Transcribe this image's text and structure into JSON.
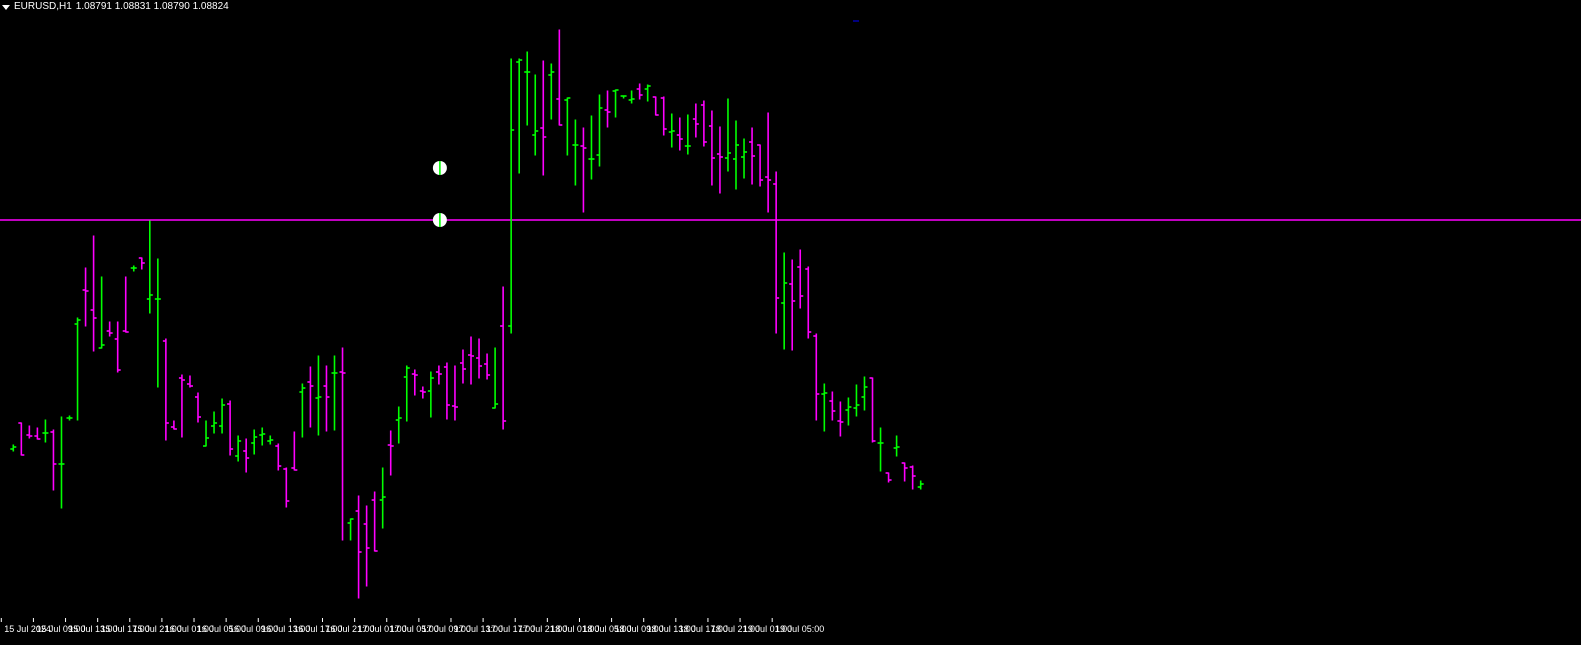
{
  "header": {
    "symbol_timeframe": "EURUSD,H1",
    "ohlc": "1.08791 1.08831 1.08790 1.08824"
  },
  "colors": {
    "background": "#000000",
    "bull": "#00ff00",
    "bear": "#ff00ff",
    "hline": "#ff00ff",
    "text": "#ffffff"
  },
  "chart_data": {
    "type": "ohlc-bar",
    "symbol": "EURUSD",
    "timeframe": "H1",
    "x_tick_labels": [
      "15 Jul 2024",
      "15 Jul 09:00",
      "15 Jul 13:00",
      "15 Jul 17:00",
      "15 Jul 21:00",
      "16 Jul 01:00",
      "16 Jul 05:00",
      "16 Jul 09:00",
      "16 Jul 13:00",
      "16 Jul 17:00",
      "16 Jul 21:00",
      "17 Jul 01:00",
      "17 Jul 05:00",
      "17 Jul 09:00",
      "17 Jul 13:00",
      "17 Jul 17:00",
      "17 Jul 21:00",
      "18 Jul 01:00",
      "18 Jul 05:00",
      "18 Jul 09:00",
      "18 Jul 13:00",
      "18 Jul 17:00",
      "18 Jul 21:00",
      "19 Jul 01:00",
      "19 Jul 05:00"
    ],
    "horizontal_line": {
      "level": 220
    },
    "markers": [
      {
        "bar": 53,
        "level": 168
      },
      {
        "bar": 53,
        "level": 220
      }
    ],
    "bars": [
      [
        449,
        447,
        445,
        451
      ],
      [
        423,
        455,
        423,
        455
      ],
      [
        435,
        436,
        426,
        438
      ],
      [
        436,
        439,
        428,
        439
      ],
      [
        433,
        433,
        420,
        442
      ],
      [
        432,
        464,
        430,
        490
      ],
      [
        464,
        464,
        417,
        508
      ],
      [
        418,
        418,
        416,
        420
      ],
      [
        324,
        320,
        318,
        420
      ],
      [
        290,
        291,
        268,
        326
      ],
      [
        310,
        318,
        236,
        351
      ],
      [
        348,
        345,
        277,
        345
      ],
      [
        331,
        333,
        322,
        336
      ],
      [
        339,
        370,
        322,
        372
      ],
      [
        331,
        332,
        277,
        332
      ],
      [
        268,
        268,
        266,
        271
      ],
      [
        258,
        263,
        258,
        269
      ],
      [
        299,
        295,
        221,
        313
      ],
      [
        299,
        299,
        259,
        387
      ],
      [
        341,
        423,
        339,
        440
      ],
      [
        427,
        429,
        421,
        429
      ],
      [
        378,
        380,
        375,
        437
      ],
      [
        384,
        386,
        376,
        387
      ],
      [
        397,
        417,
        393,
        422
      ],
      [
        446,
        438,
        421,
        446
      ],
      [
        426,
        423,
        412,
        433
      ],
      [
        426,
        405,
        399,
        433
      ],
      [
        404,
        449,
        401,
        455
      ],
      [
        456,
        441,
        436,
        461
      ],
      [
        451,
        458,
        439,
        472
      ],
      [
        443,
        437,
        430,
        454
      ],
      [
        435,
        434,
        428,
        445
      ],
      [
        441,
        440,
        436,
        444
      ],
      [
        446,
        466,
        444,
        470
      ],
      [
        469,
        501,
        468,
        507
      ],
      [
        468,
        470,
        432,
        470
      ],
      [
        392,
        388,
        384,
        437
      ],
      [
        382,
        386,
        367,
        427
      ],
      [
        398,
        397,
        356,
        435
      ],
      [
        386,
        397,
        366,
        431
      ],
      [
        373,
        373,
        356,
        430
      ],
      [
        372,
        373,
        348,
        540
      ],
      [
        523,
        519,
        523,
        540
      ],
      [
        511,
        552,
        496,
        598
      ],
      [
        524,
        548,
        506,
        586
      ],
      [
        500,
        551,
        492,
        550
      ],
      [
        500,
        497,
        468,
        528
      ],
      [
        445,
        446,
        431,
        475
      ],
      [
        420,
        418,
        407,
        443
      ],
      [
        377,
        368,
        366,
        421
      ],
      [
        374,
        375,
        370,
        395
      ],
      [
        391,
        392,
        387,
        398
      ],
      [
        391,
        378,
        372,
        417
      ],
      [
        372,
        374,
        366,
        384
      ],
      [
        367,
        405,
        363,
        419
      ],
      [
        406,
        407,
        366,
        420
      ],
      [
        363,
        369,
        350,
        383
      ],
      [
        355,
        356,
        337,
        384
      ],
      [
        358,
        366,
        339,
        378
      ],
      [
        364,
        375,
        354,
        379
      ],
      [
        408,
        404,
        348,
        406
      ],
      [
        326,
        421,
        287,
        429
      ],
      [
        326,
        130,
        59,
        333
      ],
      [
        62,
        60,
        59,
        173
      ],
      [
        72,
        72,
        52,
        125
      ],
      [
        135,
        131,
        75,
        155
      ],
      [
        128,
        137,
        61,
        175
      ],
      [
        75,
        72,
        64,
        119
      ],
      [
        99,
        125,
        30,
        125
      ],
      [
        100,
        98,
        98,
        155
      ],
      [
        145,
        145,
        120,
        185
      ],
      [
        146,
        148,
        128,
        212
      ],
      [
        159,
        159,
        116,
        179
      ],
      [
        155,
        108,
        95,
        166
      ],
      [
        110,
        112,
        91,
        127
      ],
      [
        91,
        90,
        92,
        117
      ],
      [
        96,
        96,
        96,
        98
      ],
      [
        100,
        99,
        91,
        103
      ],
      [
        89,
        95,
        84,
        99
      ],
      [
        89,
        86,
        85,
        101
      ],
      [
        97,
        115,
        108,
        115
      ],
      [
        98,
        129,
        97,
        135
      ],
      [
        132,
        131,
        114,
        147
      ],
      [
        135,
        139,
        118,
        150
      ],
      [
        146,
        146,
        115,
        154
      ],
      [
        119,
        124,
        104,
        137
      ],
      [
        105,
        142,
        101,
        146
      ],
      [
        126,
        158,
        111,
        185
      ],
      [
        154,
        157,
        127,
        193
      ],
      [
        158,
        153,
        99,
        171
      ],
      [
        159,
        145,
        121,
        189
      ],
      [
        157,
        152,
        139,
        178
      ],
      [
        142,
        156,
        128,
        184
      ],
      [
        145,
        180,
        150,
        186
      ],
      [
        177,
        180,
        113,
        212
      ],
      [
        184,
        298,
        172,
        333
      ],
      [
        303,
        283,
        253,
        349
      ],
      [
        284,
        301,
        260,
        350
      ],
      [
        267,
        296,
        250,
        308
      ],
      [
        269,
        332,
        267,
        338
      ],
      [
        336,
        394,
        334,
        420
      ],
      [
        394,
        393,
        384,
        431
      ],
      [
        401,
        411,
        392,
        420
      ],
      [
        421,
        422,
        402,
        436
      ],
      [
        410,
        407,
        398,
        425
      ],
      [
        408,
        405,
        385,
        416
      ],
      [
        397,
        387,
        377,
        410
      ],
      [
        378,
        441,
        385,
        442
      ],
      [
        443,
        443,
        428,
        471
      ],
      [
        473,
        480,
        475,
        482
      ],
      [
        448,
        447,
        436,
        456
      ],
      [
        463,
        468,
        463,
        481
      ],
      [
        467,
        476,
        466,
        489
      ],
      [
        487,
        484,
        481,
        489
      ]
    ]
  }
}
